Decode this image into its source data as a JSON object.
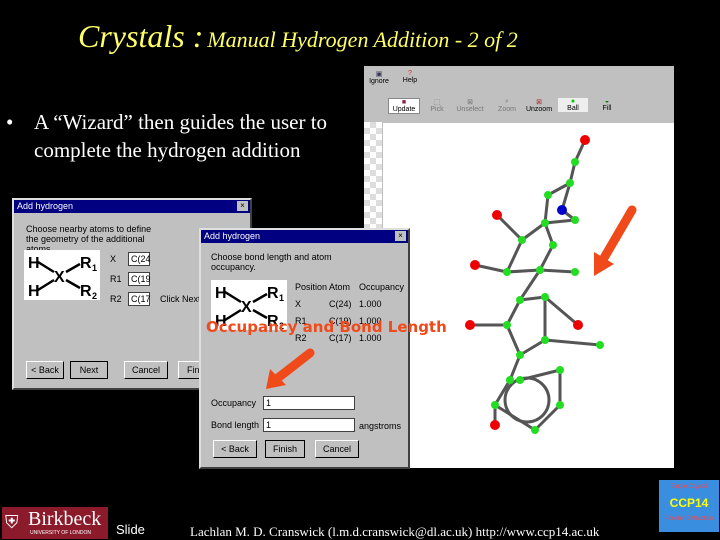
{
  "slide": {
    "title_main": "Crystals :",
    "title_sub": "Manual Hydrogen Addition - 2 of 2",
    "bullet": "A “Wizard” then guides the user to complete the hydrogen addition"
  },
  "dialog1": {
    "title": "Add hydrogen",
    "instruction": "Choose nearby atoms to define the geometry of the additional atoms.",
    "fields": [
      {
        "label": "X",
        "value": "C(24"
      },
      {
        "label": "R1",
        "value": "C(19"
      },
      {
        "label": "R2",
        "value": "C(17"
      }
    ],
    "hint": "Click Next",
    "buttons": {
      "back": "< Back",
      "next": "Next",
      "cancel": "Cancel",
      "finish": "Finish"
    }
  },
  "dialog2": {
    "title": "Add hydrogen",
    "instruction": "Choose bond length and atom occupancy.",
    "table": {
      "headers": [
        "Position",
        "Atom",
        "Occupancy"
      ],
      "rows": [
        [
          "X",
          "C(24)",
          "1.000"
        ],
        [
          "R1",
          "C(19)",
          "1.000"
        ],
        [
          "R2",
          "C(17)",
          "1.000"
        ]
      ]
    },
    "occupancy_label": "Occupancy",
    "occupancy_value": "1",
    "bond_label": "Bond length",
    "bond_value": "1",
    "bond_unit": "angstroms",
    "buttons": {
      "back": "< Back",
      "finish": "Finish",
      "cancel": "Cancel"
    }
  },
  "diagram": {
    "h1": "H",
    "h2": "H",
    "x": "X",
    "r1": "R",
    "r2": "R",
    "s1": "1",
    "s2": "2"
  },
  "annotation": "Occupancy and Bond Length",
  "viewer": {
    "toolbar1": [
      "Ignore",
      "Help"
    ],
    "toolbar2": [
      "Update",
      "Pick",
      "Unselect",
      "Zoom",
      "Unzoom",
      "Ball",
      "Fill"
    ]
  },
  "footer": {
    "logo": "Birkbeck",
    "logo_sub": "UNIVERSITY OF LONDON",
    "slide": "Slide",
    "credit": "Lachlan M. D. Cranswick (l.m.d.cranswick@dl.ac.uk) http://www.ccp14.ac.uk",
    "ccp14_top": "Single Crystal",
    "ccp14": "CCP14",
    "ccp14_bottom": "Powder Diffraction"
  }
}
